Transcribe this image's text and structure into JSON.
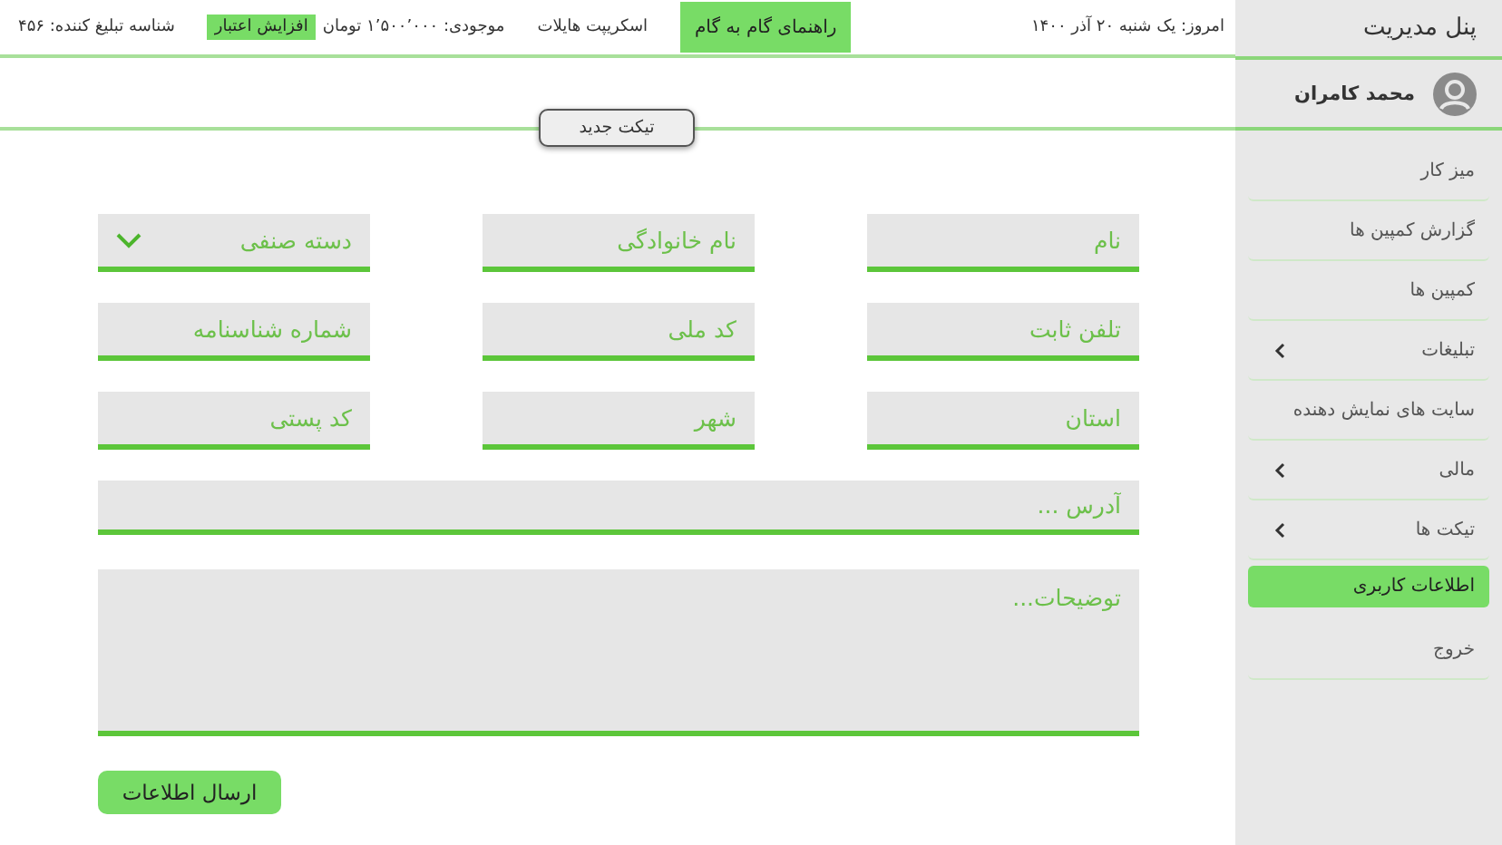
{
  "sidebar": {
    "title": "پنل مدیریت",
    "user": {
      "name": "محمد کامران"
    },
    "items": [
      {
        "label": "میز کار",
        "expandable": false,
        "selected": false
      },
      {
        "label": "گزارش کمپین ها",
        "expandable": false,
        "selected": false
      },
      {
        "label": "کمپین ها",
        "expandable": false,
        "selected": false
      },
      {
        "label": "تبلیغات",
        "expandable": true,
        "selected": false
      },
      {
        "label": "سایت های نمایش دهنده",
        "expandable": false,
        "selected": false
      },
      {
        "label": "مالی",
        "expandable": true,
        "selected": false
      },
      {
        "label": "تیکت ها",
        "expandable": true,
        "selected": false
      },
      {
        "label": "اطلاعات کاربری",
        "expandable": false,
        "selected": true
      },
      {
        "label": "خروج",
        "expandable": false,
        "selected": false
      }
    ]
  },
  "top_bar": {
    "date": "امروز: یک شنبه ۲۰ آذر ۱۴۰۰",
    "guide_button": "راهنمای گام به گام",
    "script_link": "اسکریپت هایلات",
    "balance": "موجودی: ۱٬۵۰۰٬۰۰۰ تومان",
    "credit_button": "افزایش اعتبار",
    "advertiser_id": "شناسه تبلیغ کننده: ۴۵۶"
  },
  "new_ticket_button": "تیکت جدید",
  "form": {
    "fields": [
      {
        "kind": "text",
        "placeholder": "نام"
      },
      {
        "kind": "text",
        "placeholder": "نام خانوادگی"
      },
      {
        "kind": "select",
        "placeholder": "دسته صنفی"
      },
      {
        "kind": "text",
        "placeholder": "تلفن ثابت"
      },
      {
        "kind": "text",
        "placeholder": "کد ملی"
      },
      {
        "kind": "text",
        "placeholder": "شماره شناسنامه"
      },
      {
        "kind": "text",
        "placeholder": "استان"
      },
      {
        "kind": "text",
        "placeholder": "شهر"
      },
      {
        "kind": "text",
        "placeholder": "کد پستی"
      }
    ],
    "address": {
      "placeholder": "آدرس ..."
    },
    "description": {
      "placeholder": "توضیحات..."
    },
    "submit_button": "ارسال اطلاعات"
  }
}
